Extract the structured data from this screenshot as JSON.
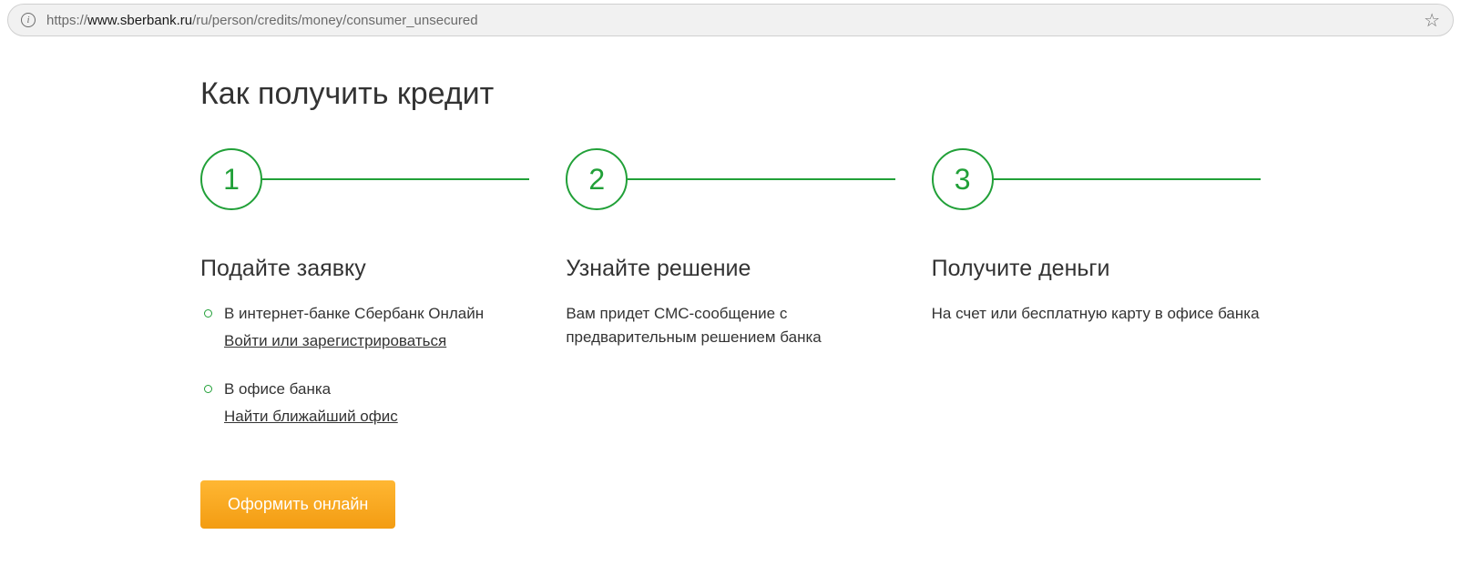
{
  "browser": {
    "url_prefix": "https://",
    "url_domain": "www.sberbank.ru",
    "url_path": "/ru/person/credits/money/consumer_unsecured"
  },
  "page": {
    "title": "Как получить кредит"
  },
  "steps": [
    {
      "number": "1",
      "title": "Подайте заявку",
      "items": [
        {
          "text": "В интернет-банке Сбербанк Онлайн",
          "link": "Войти или зарегистрироваться"
        },
        {
          "text": "В офисе банка",
          "link": "Найти ближайший офис"
        }
      ]
    },
    {
      "number": "2",
      "title": "Узнайте решение",
      "body": "Вам придет СМС-сообщение с предварительным решением банка"
    },
    {
      "number": "3",
      "title": "Получите деньги",
      "body": "На счет или бесплатную карту в офисе банка"
    }
  ],
  "cta": {
    "label": "Оформить онлайн"
  }
}
